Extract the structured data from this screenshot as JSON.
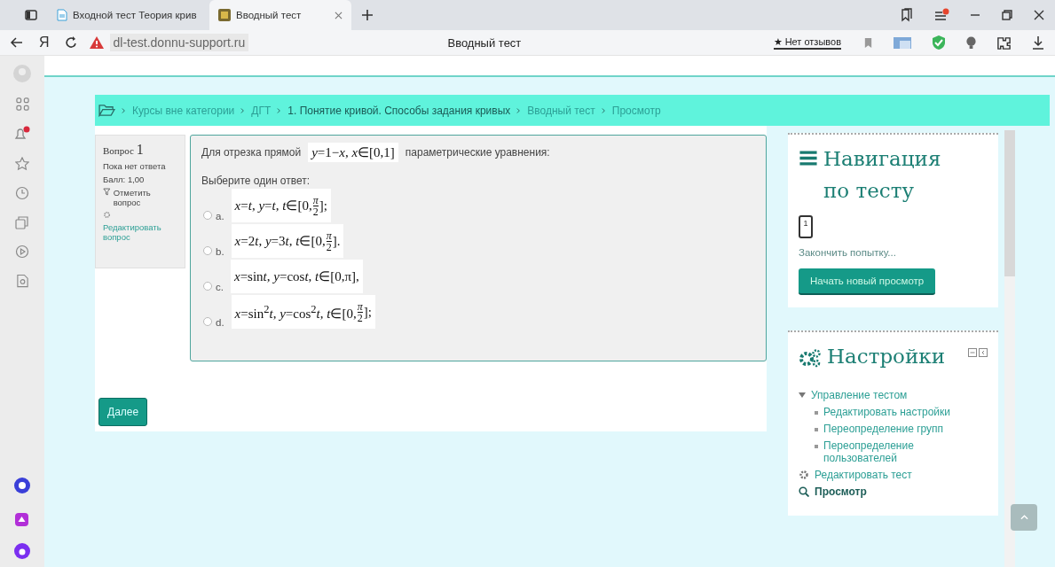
{
  "browser": {
    "tabs": [
      {
        "title": "Входной тест Теория крив",
        "selected": false,
        "kind": "doc"
      },
      {
        "title": "Вводный тест",
        "selected": true,
        "kind": "site"
      }
    ],
    "yandex_button": "Я",
    "url": "dl-test.donnu-support.ru",
    "page_title": "Вводный тест",
    "reviews": "★ Нет отзывов"
  },
  "breadcrumb": [
    "Курсы вне категории",
    "ДГТ",
    "1. Понятие кривой. Способы задания кривых",
    "Вводный тест",
    "Просмотр"
  ],
  "question_info": {
    "label": "Вопрос",
    "number": "1",
    "status": "Пока нет ответа",
    "grade": "Балл: 1,00",
    "flag": "Отметить вопрос",
    "edit": "Редактировать вопрос"
  },
  "question": {
    "text_before": "Для отрезка прямой",
    "formula": [
      {
        "kind": "text",
        "s": "*y*=1−*x*, *x*∈[0,1]"
      }
    ],
    "text_after": "параметрические уравнения:",
    "prompt": "Выберите один ответ:",
    "options": [
      {
        "letter": "a.",
        "selected": false,
        "formula": [
          {
            "kind": "text",
            "s": "*x*=*t*, *y*=*t*, *t*∈[0,"
          },
          {
            "kind": "frac",
            "num": "π",
            "den": "2"
          },
          {
            "kind": "text",
            "s": "];"
          }
        ]
      },
      {
        "letter": "b.",
        "selected": false,
        "formula": [
          {
            "kind": "text",
            "s": "*x*=2"
          },
          {
            "kind": "text",
            "s": "*t*, *y*=3"
          },
          {
            "kind": "text",
            "s": "*t*, *t*∈[0,"
          },
          {
            "kind": "frac",
            "num": "π",
            "den": "2"
          },
          {
            "kind": "text",
            "s": "]."
          }
        ]
      },
      {
        "letter": "c.",
        "selected": false,
        "formula": [
          {
            "kind": "text",
            "s": "*x*=sin"
          },
          {
            "kind": "text",
            "s": "*t*, *y*=cos"
          },
          {
            "kind": "text",
            "s": "*t*, *t*∈[0,π],"
          }
        ]
      },
      {
        "letter": "d.",
        "selected": false,
        "formula": [
          {
            "kind": "text",
            "s": "*x*=sin$^{2}$*t*, *y*=cos$^{2}$*t*, *t*∈[0,"
          },
          {
            "kind": "frac",
            "num": "π",
            "den": "2"
          },
          {
            "kind": "text",
            "s": "];"
          }
        ]
      }
    ]
  },
  "next_button": "Далее",
  "navigation": {
    "title": "Навигация по тесту",
    "questions": [
      "1"
    ],
    "finish_link": "Закончить попытку...",
    "restart_button": "Начать новый просмотр"
  },
  "settings": {
    "title": "Настройки",
    "tree": [
      {
        "label": "Управление тестом",
        "kind": "folder",
        "expanded": true,
        "children": [
          {
            "label": "Редактировать настройки"
          },
          {
            "label": "Переопределение групп"
          },
          {
            "label": "Переопределение пользователей"
          }
        ]
      },
      {
        "label": "Редактировать тест",
        "kind": "gear"
      },
      {
        "label": "Просмотр",
        "kind": "search"
      }
    ]
  }
}
